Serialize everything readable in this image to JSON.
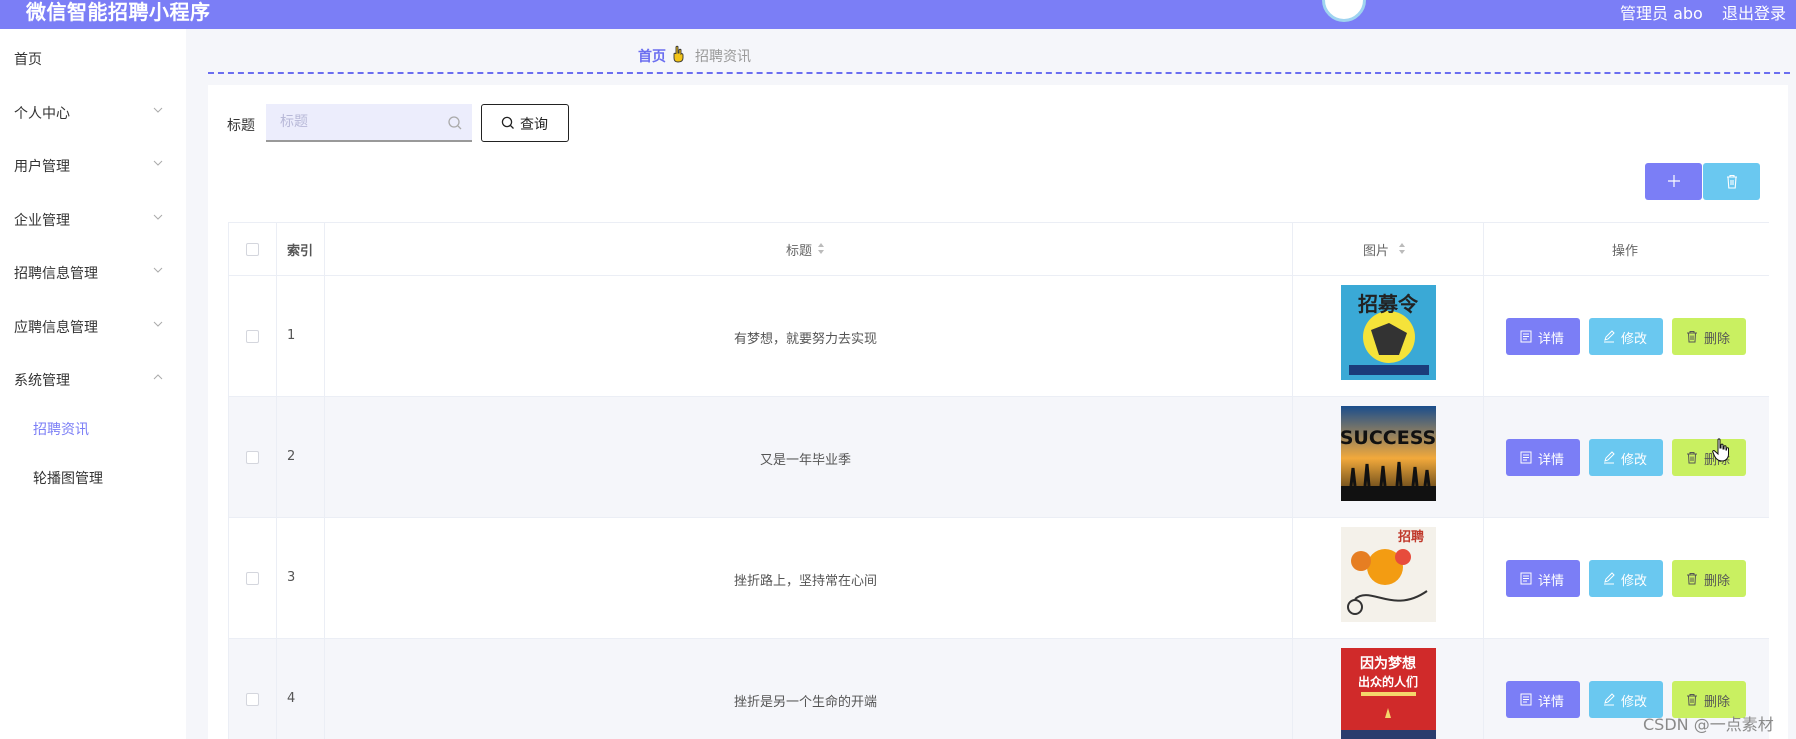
{
  "header": {
    "app_title": "微信智能招聘小程序",
    "admin_label": "管理员 abo",
    "logout": "退出登录"
  },
  "sidebar": {
    "items": [
      {
        "label": "首页"
      },
      {
        "label": "个人中心"
      },
      {
        "label": "用户管理"
      },
      {
        "label": "企业管理"
      },
      {
        "label": "招聘信息管理"
      },
      {
        "label": "应聘信息管理"
      },
      {
        "label": "系统管理"
      }
    ],
    "subitems": [
      {
        "label": "招聘资讯",
        "active": true
      },
      {
        "label": "轮播图管理",
        "active": false
      }
    ]
  },
  "breadcrumb": {
    "home": "首页",
    "current": "招聘资讯"
  },
  "search": {
    "label": "标题",
    "placeholder": "标题",
    "value": "",
    "query_button": "查询"
  },
  "table": {
    "columns": {
      "index": "索引",
      "title": "标题",
      "image": "图片",
      "actions": "操作"
    },
    "rows": [
      {
        "index": "1",
        "title": "有梦想，就要努力去实现",
        "image": "招募令 poster"
      },
      {
        "index": "2",
        "title": "又是一年毕业季",
        "image": "SUCCESS poster"
      },
      {
        "index": "3",
        "title": "挫折路上，坚持常在心间",
        "image": "招聘 poster"
      },
      {
        "index": "4",
        "title": "挫折是另一个生命的开端",
        "image": "因为梦想 poster"
      }
    ],
    "actions": {
      "detail": "详情",
      "edit": "修改",
      "delete": "删除"
    }
  },
  "watermark": "CSDN @一点素材",
  "colors": {
    "primary": "#7b7ef6",
    "info": "#6ac8f0",
    "warning": "#c9f061"
  }
}
